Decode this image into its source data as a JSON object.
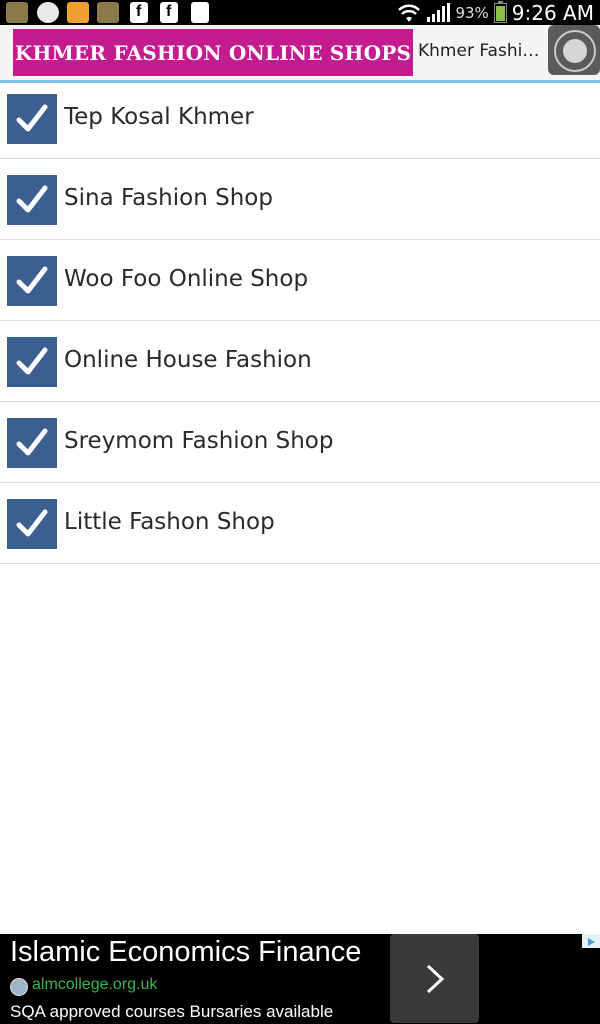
{
  "status_bar": {
    "battery_percent": "93%",
    "time": "9:26 AM",
    "notification_icons": [
      "talking-tom-icon",
      "messenger-icon",
      "burger-game-icon",
      "talking-tom-icon",
      "facebook-icon",
      "facebook-icon",
      "document-icon"
    ]
  },
  "header": {
    "banner_text": "KHMER FASHION ONLINE SHOPS",
    "title": "Khmer Fashi…",
    "banner_color": "#c21c8f"
  },
  "list": {
    "items": [
      {
        "label": "Tep Kosal Khmer",
        "checked": true
      },
      {
        "label": "Sina Fashion Shop",
        "checked": true
      },
      {
        "label": "Woo Foo Online Shop",
        "checked": true
      },
      {
        "label": "Online House Fashion",
        "checked": true
      },
      {
        "label": "Sreymom Fashion Shop",
        "checked": true
      },
      {
        "label": "Little Fashon Shop",
        "checked": true
      }
    ],
    "checkbox_color": "#3c5f91"
  },
  "ad": {
    "title": "Islamic Economics Finance",
    "url": "almcollege.org.uk",
    "description": "SQA approved courses Bursaries available"
  }
}
